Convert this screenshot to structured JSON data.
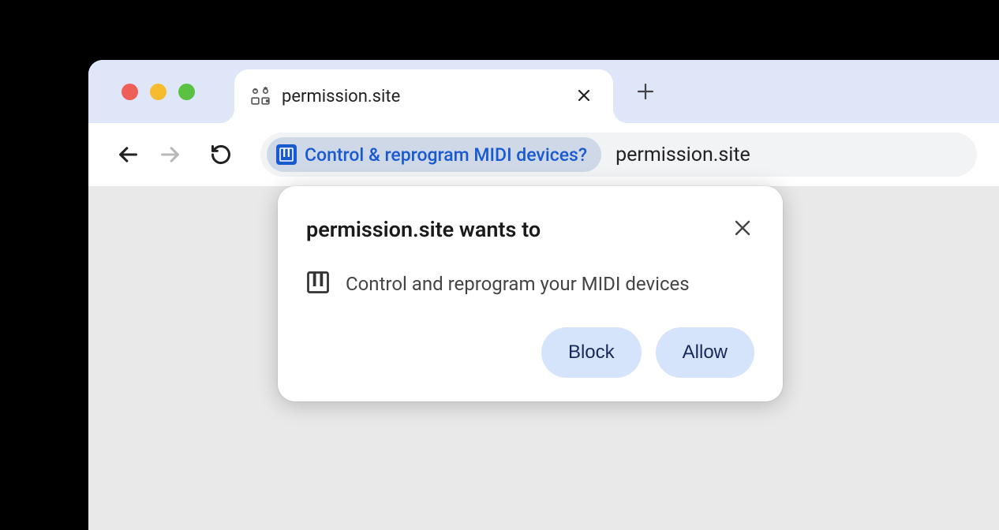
{
  "tab": {
    "title": "permission.site"
  },
  "toolbar": {
    "chip_text": "Control & reprogram MIDI devices?",
    "url": "permission.site"
  },
  "popup": {
    "title": "permission.site wants to",
    "body": "Control and reprogram your MIDI devices",
    "block_label": "Block",
    "allow_label": "Allow"
  }
}
